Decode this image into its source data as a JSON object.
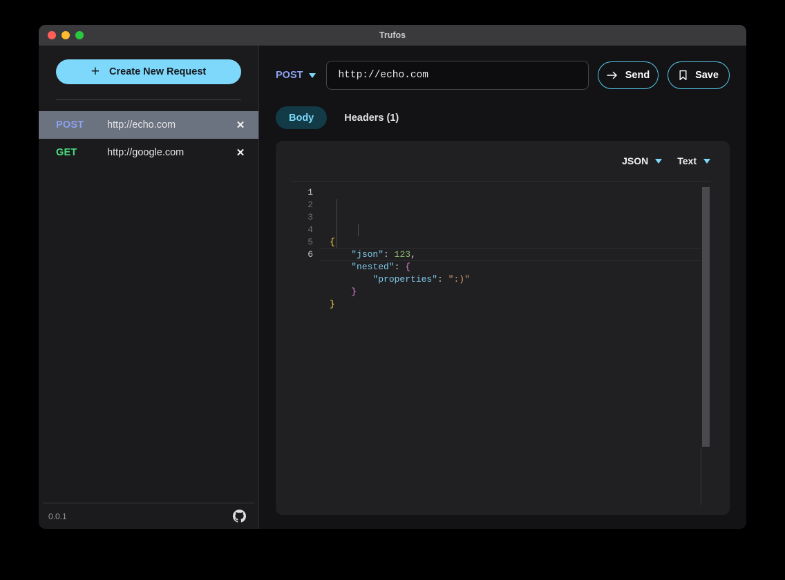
{
  "window": {
    "title": "Trufos",
    "traffic_lights": [
      {
        "name": "close",
        "color": "#ff5f57"
      },
      {
        "name": "minimize",
        "color": "#febc2e"
      },
      {
        "name": "maximize",
        "color": "#28c840"
      }
    ]
  },
  "sidebar": {
    "create_button": {
      "label": "Create New Request",
      "icon": "plus-icon"
    },
    "requests": [
      {
        "method": "POST",
        "method_color": "#8da2f0",
        "url": "http://echo.com",
        "selected": true,
        "close_icon": "close-icon"
      },
      {
        "method": "GET",
        "method_color": "#4ade80",
        "url": "http://google.com",
        "selected": false,
        "close_icon": "close-icon"
      }
    ],
    "footer": {
      "version": "0.0.1",
      "github_icon": "github-icon"
    }
  },
  "main": {
    "url_bar": {
      "method": "POST",
      "method_caret_icon": "chevron-down-icon",
      "url_value": "http://echo.com",
      "url_placeholder": "http://",
      "send_label": "Send",
      "send_icon": "arrow-right-icon",
      "save_label": "Save",
      "save_icon": "bookmark-icon"
    },
    "tabs": [
      {
        "label": "Body",
        "active": true
      },
      {
        "label": "Headers (1)",
        "active": false
      }
    ],
    "editor": {
      "format_select": {
        "value": "JSON",
        "caret_icon": "chevron-down-icon"
      },
      "view_select": {
        "value": "Text",
        "caret_icon": "chevron-down-icon"
      },
      "line_numbers": [
        "1",
        "2",
        "3",
        "4",
        "5",
        "6"
      ],
      "code_text": "{\n    \"json\": 123,\n    \"nested\": {\n        \"properties\": \":)\"\n    }\n}",
      "syntax_colors": {
        "brace_outer": "#ffd43b",
        "brace_nested": "#e085d6",
        "key": "#7fc9ea",
        "number": "#8fbc6e",
        "string": "#d99a6c",
        "punctuation": "#cfcfd4"
      }
    }
  },
  "theme": {
    "accent": "#7dd8fb",
    "window_bg": "#1b1b1d",
    "main_bg": "#131315",
    "card_bg": "#202023",
    "titlebar_bg": "#3a3a3c",
    "selected_row_bg": "#6b7280"
  }
}
